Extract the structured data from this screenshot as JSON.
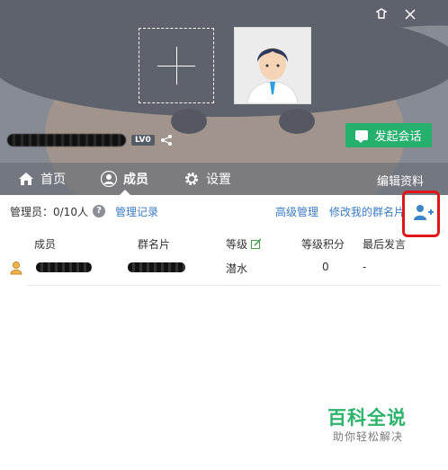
{
  "window": {
    "controls": {
      "skin_icon": "skin-icon",
      "close_icon": "close-icon"
    }
  },
  "header": {
    "level_badge": "LV0",
    "start_chat_label": "发起会话",
    "accent_color": "#26b06e"
  },
  "tabs": [
    {
      "label": "首页",
      "icon": "home-icon"
    },
    {
      "label": "成员",
      "icon": "person-icon",
      "active": true
    },
    {
      "label": "设置",
      "icon": "gear-icon"
    }
  ],
  "edit_profile_label": "编辑资料",
  "admin": {
    "label": "管理员：0/10人",
    "records_link": "管理记录",
    "advanced_link": "高级管理",
    "edit_card_link": "修改我的群名片"
  },
  "table": {
    "headers": [
      "成员",
      "群名片",
      "等级",
      "等级积分",
      "最后发言"
    ],
    "rows": [
      {
        "level": "潜水",
        "points": "0",
        "last_speak": "-"
      }
    ]
  },
  "watermark": {
    "title": "百科全说",
    "subtitle": "助你轻松解决"
  }
}
